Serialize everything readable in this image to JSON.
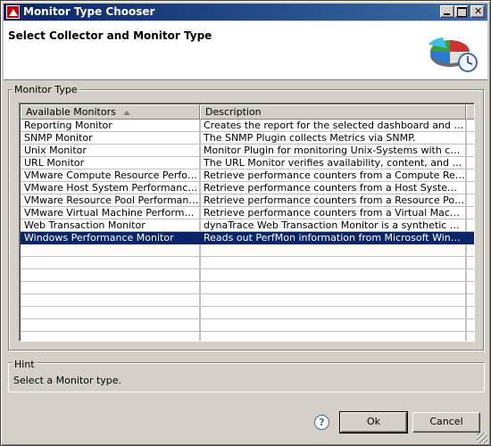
{
  "window": {
    "title": "Monitor Type Chooser",
    "title_bar_color": "#0a246a"
  },
  "banner": {
    "heading": "Select Collector and Monitor Type",
    "icon": "pie-chart-clock-icon"
  },
  "monitor_group": {
    "label": "Monitor Type",
    "columns": [
      "Available Monitors",
      "Description"
    ],
    "rows": [
      {
        "name": "Reporting Monitor",
        "description": "Creates the report for the selected dashboard and provi..."
      },
      {
        "name": "SNMP Monitor",
        "description": "The SNMP Plugin collects Metrics via SNMP."
      },
      {
        "name": "Unix Monitor",
        "description": "Monitor Plugin for monitoring Unix-Systems with common ..."
      },
      {
        "name": "URL Monitor",
        "description": "The URL Monitor verifies availability, content, and access..."
      },
      {
        "name": "VMware Compute Resource Performa...",
        "description": "Retrieve performance counters from a Compute Resourc..."
      },
      {
        "name": "VMware Host System Performance M...",
        "description": "Retrieve performance counters from a Host System withi..."
      },
      {
        "name": "VMware Resource Pool Performance ...",
        "description": "Retrieve performance counters from a Resource Pool wit..."
      },
      {
        "name": "VMware Virtual Machine Performance ...",
        "description": "Retrieve performance counters from a Virtual Machine wit..."
      },
      {
        "name": "Web Transaction Monitor",
        "description": "dynaTrace Web Transaction Monitor is a synthetic Web T..."
      },
      {
        "name": "Windows Performance Monitor",
        "description": "Reads out PerfMon information from Microsoft Windows S..."
      }
    ],
    "selected_index": 9,
    "selection_color": "#0a246a"
  },
  "hint_group": {
    "label": "Hint",
    "text": "Select a Monitor type."
  },
  "buttons": {
    "help": "?",
    "ok": "Ok",
    "cancel": "Cancel"
  }
}
